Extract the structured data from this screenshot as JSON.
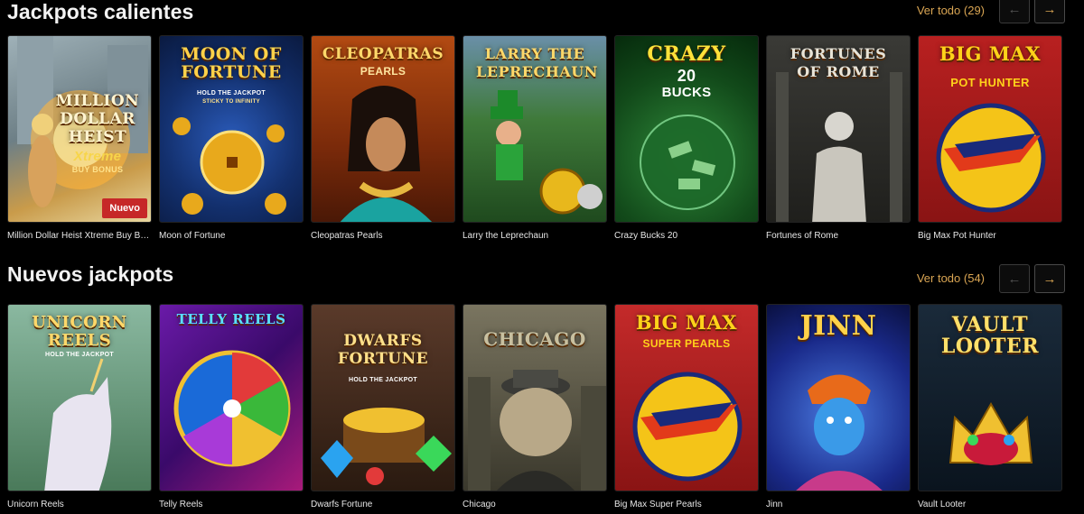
{
  "sections": [
    {
      "title": "Jackpots calientes",
      "see_all": "Ver todo (29)",
      "prev_icon": "←",
      "next_icon": "→",
      "games": [
        {
          "name": "Million Dollar Heist Xtreme Buy Bonus",
          "art_title": "MILLION DOLLAR HEIST",
          "art_sub": "Xtreme",
          "art_sub2": "BUY BONUS",
          "badge": "Nuevo"
        },
        {
          "name": "Moon of Fortune",
          "art_title": "MOON OF FORTUNE",
          "art_sub": "HOLD THE JACKPOT",
          "art_sub2": "STICKY TO INFINITY"
        },
        {
          "name": "Cleopatras Pearls",
          "art_title": "CLEOPATRAS",
          "art_sub": "PEARLS"
        },
        {
          "name": "Larry the Leprechaun",
          "art_title": "LARRY THE LEPRECHAUN"
        },
        {
          "name": "Crazy Bucks 20",
          "art_title": "CRAZY",
          "art_sub": "20",
          "art_sub2": "BUCKS"
        },
        {
          "name": "Fortunes of Rome",
          "art_title": "FORTUNES OF ROME"
        },
        {
          "name": "Big Max Pot Hunter",
          "art_title": "BIG MAX",
          "art_sub": "POT HUNTER"
        }
      ]
    },
    {
      "title": "Nuevos jackpots",
      "see_all": "Ver todo (54)",
      "prev_icon": "←",
      "next_icon": "→",
      "games": [
        {
          "name": "Unicorn Reels",
          "art_title": "UNICORN REELS",
          "art_sub": "HOLD THE JACKPOT"
        },
        {
          "name": "Telly Reels",
          "art_title": "TELLY REELS"
        },
        {
          "name": "Dwarfs Fortune",
          "art_title": "DWARFS FORTUNE",
          "art_sub": "HOLD THE JACKPOT"
        },
        {
          "name": "Chicago",
          "art_title": "CHICAGO"
        },
        {
          "name": "Big Max Super Pearls",
          "art_title": "BIG MAX",
          "art_sub": "SUPER PEARLS"
        },
        {
          "name": "Jinn",
          "art_title": "JINN"
        },
        {
          "name": "Vault Looter",
          "art_title": "VAULT LOOTER"
        }
      ]
    }
  ],
  "colors": {
    "background": "#000000",
    "accent": "#d9a553",
    "badge": "#c62828"
  }
}
